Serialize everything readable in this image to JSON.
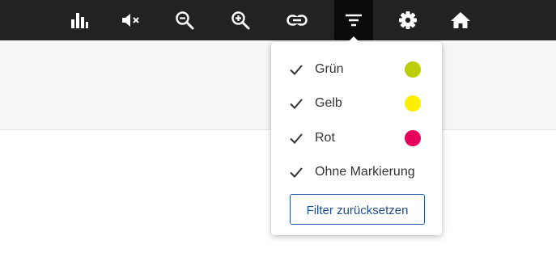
{
  "toolbar": {
    "buttons": [
      {
        "icon": "bar-chart-icon"
      },
      {
        "icon": "mute-icon"
      },
      {
        "icon": "zoom-out-icon"
      },
      {
        "icon": "zoom-in-icon"
      },
      {
        "icon": "link-icon"
      },
      {
        "icon": "filter-icon",
        "active": true
      },
      {
        "icon": "gear-icon"
      },
      {
        "icon": "home-icon"
      }
    ]
  },
  "filter_menu": {
    "items": [
      {
        "label": "Grün",
        "checked": true,
        "color": "#bccd0a"
      },
      {
        "label": "Gelb",
        "checked": true,
        "color": "#ffee00"
      },
      {
        "label": "Rot",
        "checked": true,
        "color": "#e6005c"
      },
      {
        "label": "Ohne Markierung",
        "checked": true
      }
    ],
    "reset_label": "Filter zurücksetzen"
  },
  "colors": {
    "toolbar_bg": "#222222",
    "accent": "#1f5aa6"
  }
}
